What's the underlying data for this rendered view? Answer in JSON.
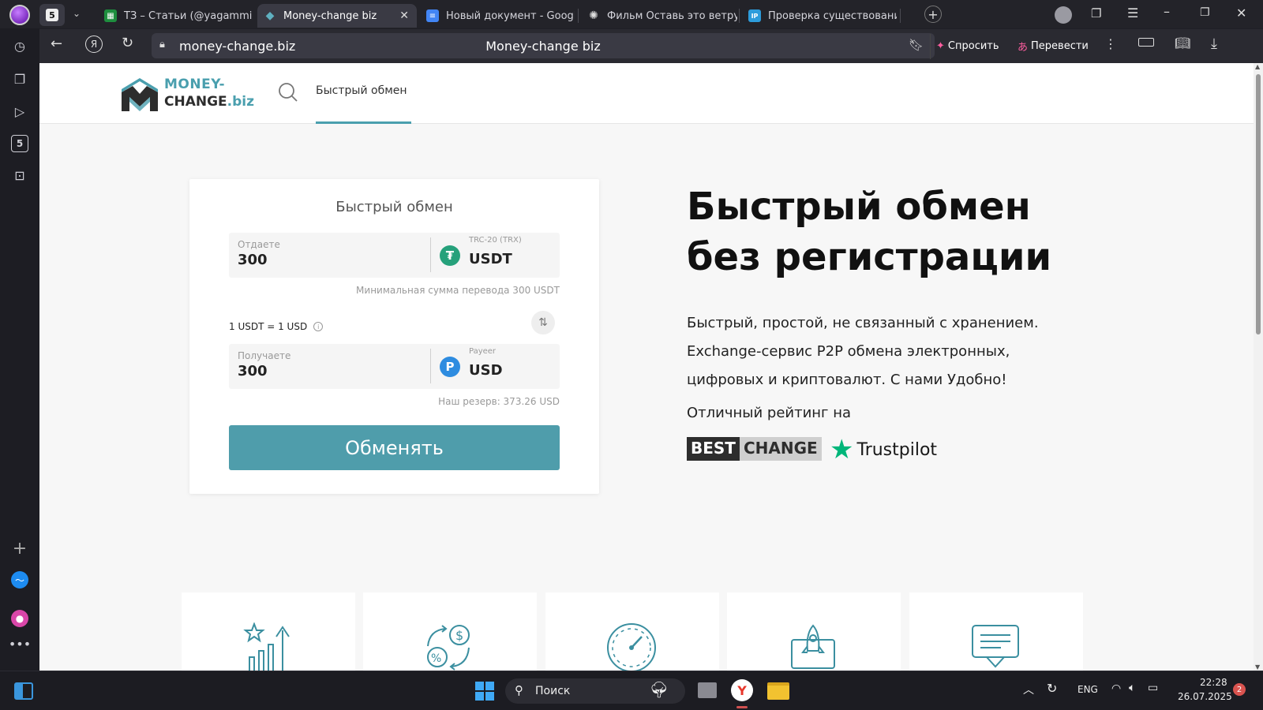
{
  "tabs": [
    {
      "label": "ТЗ – Статьи (@yagammi)"
    },
    {
      "label": "Money-change biz"
    },
    {
      "label": "Новый документ - Google"
    },
    {
      "label": "Фильм Оставь это ветру"
    },
    {
      "label": "Проверка существовани"
    }
  ],
  "tab_group_count": "5",
  "address": {
    "url": "money-change.biz",
    "page_title": "Money-change biz"
  },
  "toolbar": {
    "ask_label": "Спросить",
    "translate_label": "Перевести"
  },
  "sidebar": {
    "badge": "5"
  },
  "header": {
    "logo_line1": "MONEY-",
    "logo_line2": "CHANGE",
    "logo_line2_suffix": ".biz",
    "nav_item": "Быстрый обмен"
  },
  "exchange": {
    "title": "Быстрый обмен",
    "give_label": "Отдаете",
    "give_value": "300",
    "give_network": "TRC-20 (TRX)",
    "give_currency": "USDT",
    "give_icon": "tether-icon",
    "min_hint": "Минимальная сумма перевода 300 USDT",
    "rate": "1 USDT = 1 USD",
    "receive_label": "Получаете",
    "receive_value": "300",
    "receive_network": "Payeer",
    "receive_currency": "USD",
    "receive_icon": "payeer-icon",
    "reserve_hint": "Наш резерв: 373.26 USD",
    "button_label": "Обменять"
  },
  "hero": {
    "title_line1": "Быстрый обмен",
    "title_line2": "без регистрации",
    "desc_line1": "Быстрый, простой, не связанный с хранением.",
    "desc_line2": "Exchange-сервис P2P обмена электронных,",
    "desc_line3": "цифровых и криптовалют. С нами Удобно!",
    "rating_label": "Отличный рейтинг на",
    "bestchange_1": "BEST",
    "bestchange_2": "CHANGE",
    "trustpilot": "Trustpilot"
  },
  "feature_icons": [
    "rating-growth-icon",
    "exchange-percent-icon",
    "speedometer-icon",
    "rocket-launch-icon",
    "chat-support-icon"
  ],
  "taskbar": {
    "search_placeholder": "Поиск",
    "lang": "ENG",
    "time": "22:28",
    "date": "26.07.2025",
    "notifications": "2"
  },
  "colors": {
    "accent": "#4f9dab",
    "tether": "#26a17b",
    "payeer": "#2e8ce0"
  }
}
